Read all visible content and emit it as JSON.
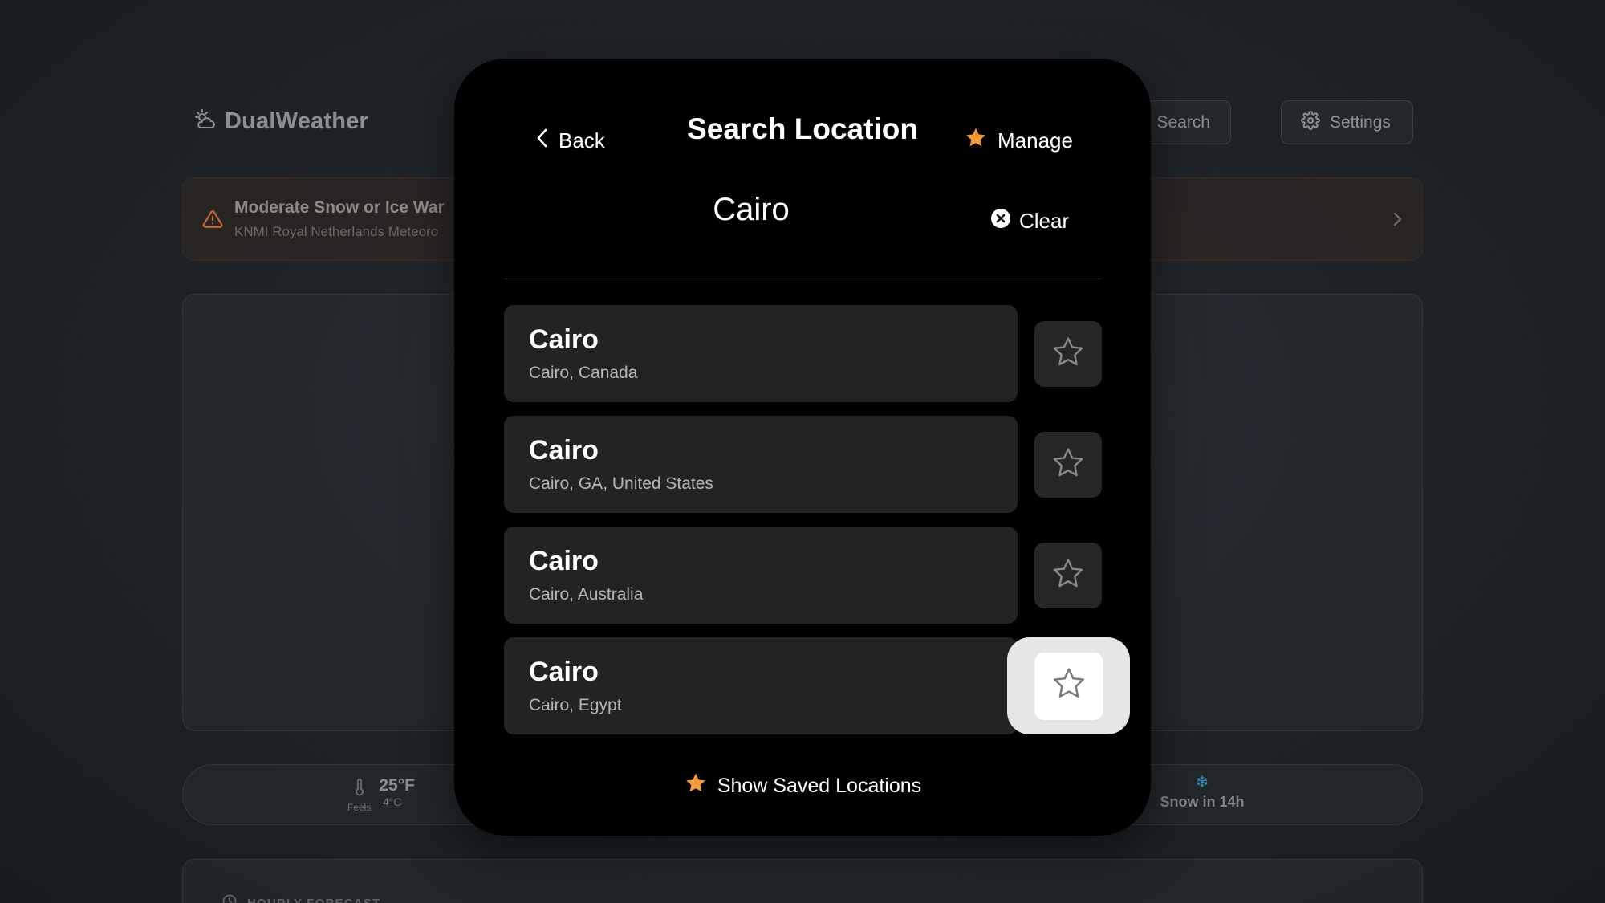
{
  "app": {
    "name": "DualWeather",
    "search_label": "Search",
    "settings_label": "Settings"
  },
  "alert": {
    "title": "Moderate Snow or Ice War",
    "source": "KNMI Royal Netherlands Meteoro"
  },
  "stats": {
    "feels_label": "Feels",
    "temp_f": "25°F",
    "temp_c": "-4°C",
    "snow_text": "Snow in 14h"
  },
  "hourly": {
    "title": "HOURLY FORECAST"
  },
  "modal": {
    "back_label": "Back",
    "title": "Search Location",
    "manage_label": "Manage",
    "query": "Cairo",
    "clear_label": "Clear",
    "results": [
      {
        "name": "Cairo",
        "detail": "Cairo, Canada"
      },
      {
        "name": "Cairo",
        "detail": "Cairo, GA, United States"
      },
      {
        "name": "Cairo",
        "detail": "Cairo, Australia"
      },
      {
        "name": "Cairo",
        "detail": "Cairo, Egypt"
      }
    ],
    "saved_label": "Show Saved Locations"
  },
  "colors": {
    "accent_star": "#f39a3c",
    "modal_bg": "#000000",
    "card_bg": "#232323",
    "alert_icon": "#c26a3a"
  },
  "icons": {
    "brand": "cloud-sun-icon",
    "search": "search-icon",
    "settings": "gear-icon",
    "alert": "warning-icon",
    "back": "chevron-left-icon",
    "manage": "star-filled-icon",
    "clear": "x-circle-icon",
    "favorite": "star-outline-icon"
  }
}
